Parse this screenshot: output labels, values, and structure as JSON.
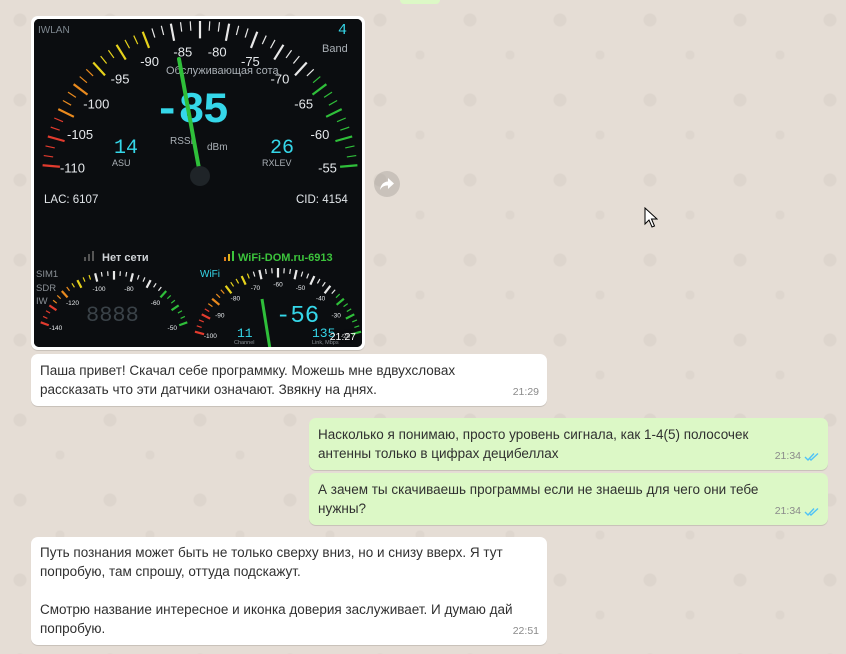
{
  "chat": {
    "image_message": {
      "time": "21:27",
      "screenshot": {
        "iwlan": "IWLAN",
        "band_value": "4",
        "band_label": "Band",
        "title": "Обслуживающая сота",
        "signal": "-85",
        "rssi_label": "RSSI",
        "dbm_label": "dBm",
        "asu_value": "14",
        "asu_label": "ASU",
        "rxlev_value": "26",
        "rxlev_label": "RXLEV",
        "lac": "LAC:  6107",
        "cid": "CID:  4154",
        "no_network": "Нет сети",
        "wifi_name": "WiFi-DOM.ru-6913",
        "wifi_label": "WiFi",
        "sim_labels": [
          "SIM1",
          "SDR",
          "IW"
        ],
        "wifi_signal": "-56",
        "channel_value": "11",
        "channel_label": "Channel",
        "link_value": "135",
        "link_label": "Link, Mbps",
        "main_scale": [
          "-110",
          "-105",
          "-100",
          "-95",
          "-90",
          "-85",
          "-80",
          "-75",
          "-70",
          "-65",
          "-60",
          "-55"
        ],
        "sim_scale": [
          "-140",
          "-120",
          "-100",
          "-80",
          "-60",
          "-50"
        ],
        "wifi_scale": [
          "-100",
          "-90",
          "-80",
          "-70",
          "-60",
          "-50",
          "-40",
          "-30",
          "-20"
        ]
      }
    },
    "messages": [
      {
        "direction": "in",
        "text": "Паша привет! Скачал себе программку. Можешь мне вдвухсловах\nрассказать что эти датчики означают. Звякну на днях.",
        "time": "21:29"
      },
      {
        "direction": "out",
        "text": "Насколько я понимаю, просто уровень сигнала, как 1-4(5) полосочек\nантенны только в цифрах децибеллах",
        "time": "21:34"
      },
      {
        "direction": "out",
        "text": "А зачем ты скачиваешь программы если не знаешь для чего они тебе\nнужны?",
        "time": "21:34"
      },
      {
        "direction": "in",
        "text": "Путь познания может быть не только сверху вниз, но и снизу вверх. Я тут\nпопробую, там спрошу, оттуда подскажут.\n\nСмотрю название интересное и иконка доверия заслуживает. И думаю дай\nпопробую.",
        "time": "22:51"
      }
    ]
  },
  "icons": {
    "forward": "forward-icon",
    "read_receipt": "double-check-icon",
    "cursor": "mouse-cursor-icon"
  },
  "colors": {
    "bubble_in": "#ffffff",
    "bubble_out": "#dcf8c6",
    "read_tick": "#4fc3f7",
    "gauge_digits": "#35d7e9",
    "wifi_green": "#3cc43c"
  }
}
